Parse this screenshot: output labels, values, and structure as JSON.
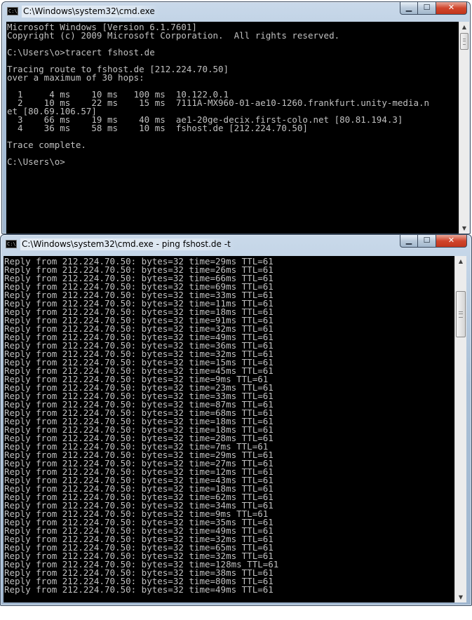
{
  "window1": {
    "title": "C:\\Windows\\system32\\cmd.exe",
    "lines": [
      "Microsoft Windows [Version 6.1.7601]",
      "Copyright (c) 2009 Microsoft Corporation.  All rights reserved.",
      "",
      "C:\\Users\\o>tracert fshost.de",
      "",
      "Tracing route to fshost.de [212.224.70.50]",
      "over a maximum of 30 hops:",
      "",
      "  1     4 ms    10 ms   100 ms  10.122.0.1",
      "  2    10 ms    22 ms    15 ms  7111A-MX960-01-ae10-1260.frankfurt.unity-media.n",
      "et [80.69.106.57]",
      "  3    66 ms    19 ms    40 ms  ae1-20ge-decix.first-colo.net [80.81.194.3]",
      "  4    36 ms    58 ms    10 ms  fshost.de [212.224.70.50]",
      "",
      "Trace complete.",
      "",
      "C:\\Users\\o>"
    ]
  },
  "window2": {
    "title": "C:\\Windows\\system32\\cmd.exe - ping  fshost.de -t",
    "lines": [
      "Reply from 212.224.70.50: bytes=32 time=29ms TTL=61",
      "Reply from 212.224.70.50: bytes=32 time=26ms TTL=61",
      "Reply from 212.224.70.50: bytes=32 time=66ms TTL=61",
      "Reply from 212.224.70.50: bytes=32 time=69ms TTL=61",
      "Reply from 212.224.70.50: bytes=32 time=33ms TTL=61",
      "Reply from 212.224.70.50: bytes=32 time=11ms TTL=61",
      "Reply from 212.224.70.50: bytes=32 time=18ms TTL=61",
      "Reply from 212.224.70.50: bytes=32 time=91ms TTL=61",
      "Reply from 212.224.70.50: bytes=32 time=32ms TTL=61",
      "Reply from 212.224.70.50: bytes=32 time=49ms TTL=61",
      "Reply from 212.224.70.50: bytes=32 time=36ms TTL=61",
      "Reply from 212.224.70.50: bytes=32 time=32ms TTL=61",
      "Reply from 212.224.70.50: bytes=32 time=15ms TTL=61",
      "Reply from 212.224.70.50: bytes=32 time=45ms TTL=61",
      "Reply from 212.224.70.50: bytes=32 time=9ms TTL=61",
      "Reply from 212.224.70.50: bytes=32 time=23ms TTL=61",
      "Reply from 212.224.70.50: bytes=32 time=33ms TTL=61",
      "Reply from 212.224.70.50: bytes=32 time=87ms TTL=61",
      "Reply from 212.224.70.50: bytes=32 time=68ms TTL=61",
      "Reply from 212.224.70.50: bytes=32 time=18ms TTL=61",
      "Reply from 212.224.70.50: bytes=32 time=18ms TTL=61",
      "Reply from 212.224.70.50: bytes=32 time=28ms TTL=61",
      "Reply from 212.224.70.50: bytes=32 time=7ms TTL=61",
      "Reply from 212.224.70.50: bytes=32 time=29ms TTL=61",
      "Reply from 212.224.70.50: bytes=32 time=27ms TTL=61",
      "Reply from 212.224.70.50: bytes=32 time=12ms TTL=61",
      "Reply from 212.224.70.50: bytes=32 time=43ms TTL=61",
      "Reply from 212.224.70.50: bytes=32 time=18ms TTL=61",
      "Reply from 212.224.70.50: bytes=32 time=62ms TTL=61",
      "Reply from 212.224.70.50: bytes=32 time=34ms TTL=61",
      "Reply from 212.224.70.50: bytes=32 time=9ms TTL=61",
      "Reply from 212.224.70.50: bytes=32 time=35ms TTL=61",
      "Reply from 212.224.70.50: bytes=32 time=49ms TTL=61",
      "Reply from 212.224.70.50: bytes=32 time=32ms TTL=61",
      "Reply from 212.224.70.50: bytes=32 time=65ms TTL=61",
      "Reply from 212.224.70.50: bytes=32 time=32ms TTL=61",
      "Reply from 212.224.70.50: bytes=32 time=128ms TTL=61",
      "Reply from 212.224.70.50: bytes=32 time=38ms TTL=61",
      "Reply from 212.224.70.50: bytes=32 time=80ms TTL=61",
      "Reply from 212.224.70.50: bytes=32 time=49ms TTL=61"
    ]
  },
  "controls": {
    "minimize": "▁",
    "maximize": "☐",
    "close": "✕"
  },
  "icons": {
    "app": "console-app-icon",
    "minimize": "minimize-icon",
    "maximize": "maximize-icon",
    "close": "close-icon",
    "scroll_up": "arrow-up-icon",
    "scroll_down": "arrow-down-icon"
  },
  "colors": {
    "console_bg": "#000000",
    "console_text": "#c0c0c0",
    "close_button": "#c9402a"
  }
}
